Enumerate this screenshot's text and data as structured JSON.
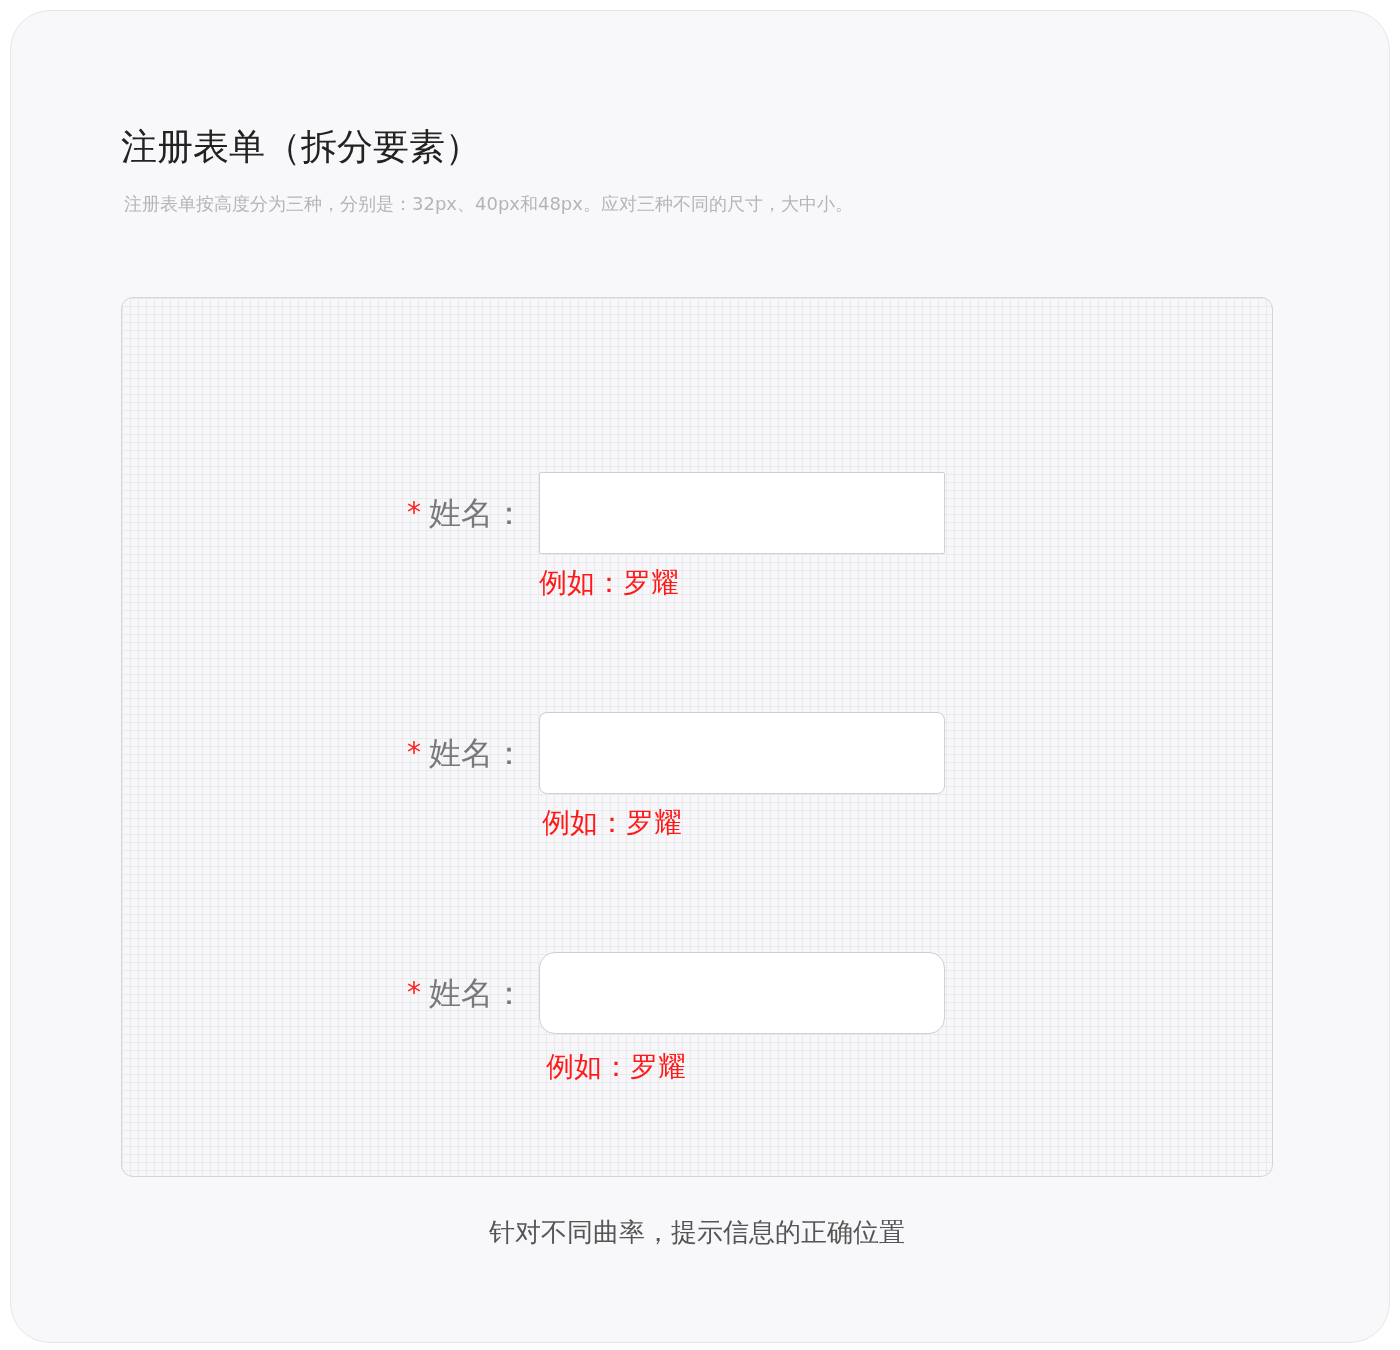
{
  "title": "注册表单（拆分要素）",
  "subtitle": "注册表单按高度分为三种，分别是：32px、40px和48px。应对三种不同的尺寸，大中小。",
  "fields": [
    {
      "kind": "sharp",
      "marker": "*",
      "label": "姓名：",
      "hint": "例如：罗耀"
    },
    {
      "kind": "rounded",
      "marker": "*",
      "label": "姓名：",
      "hint": "例如：罗耀"
    },
    {
      "kind": "round",
      "marker": "*",
      "label": "姓名：",
      "hint": "例如：罗耀"
    }
  ],
  "caption": "针对不同曲率，提示信息的正确位置"
}
